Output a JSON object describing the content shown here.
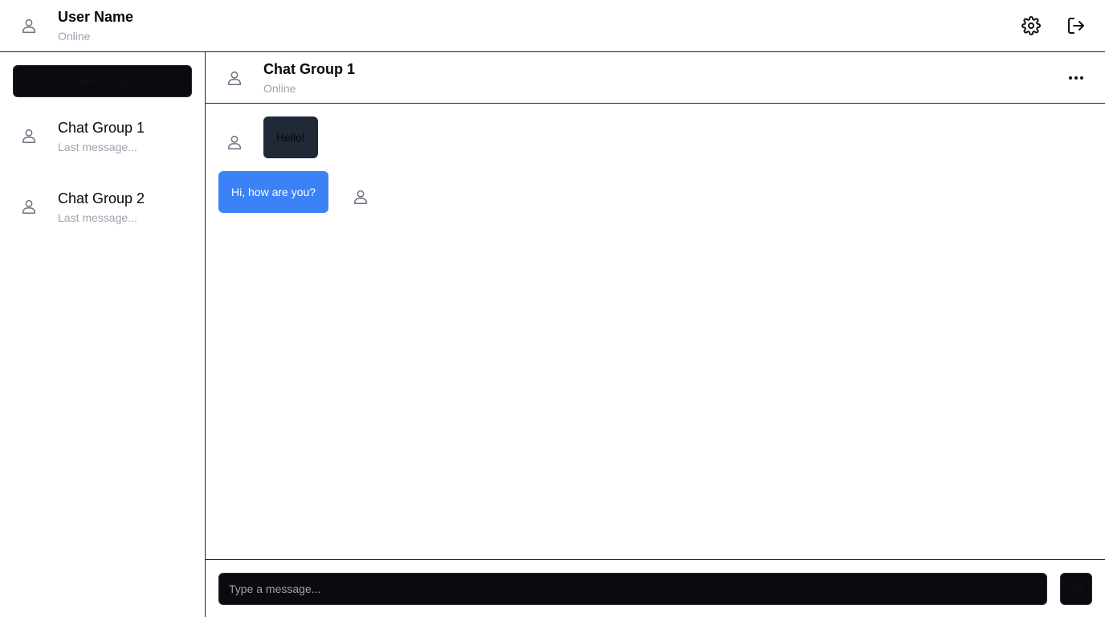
{
  "user": {
    "name": "User Name",
    "status": "Online"
  },
  "header_icons": {
    "settings": "gear-icon",
    "logout": "logout-icon"
  },
  "sidebar": {
    "new_group_label": "New Group",
    "chats": [
      {
        "name": "Chat Group 1",
        "last_message": "Last message..."
      },
      {
        "name": "Chat Group 2",
        "last_message": "Last message..."
      }
    ]
  },
  "chat": {
    "title": "Chat Group 1",
    "status": "Online",
    "messages": [
      {
        "text": "Hello!",
        "side": "left"
      },
      {
        "text": "Hi, how are you?",
        "side": "right"
      }
    ]
  },
  "composer": {
    "placeholder": "Type a message...",
    "send_icon": "send-icon"
  },
  "colors": {
    "accent": "#3b82f6",
    "dark": "#0b0b0f",
    "muted": "#9ca3af",
    "bubble_dark": "#1f2937"
  }
}
